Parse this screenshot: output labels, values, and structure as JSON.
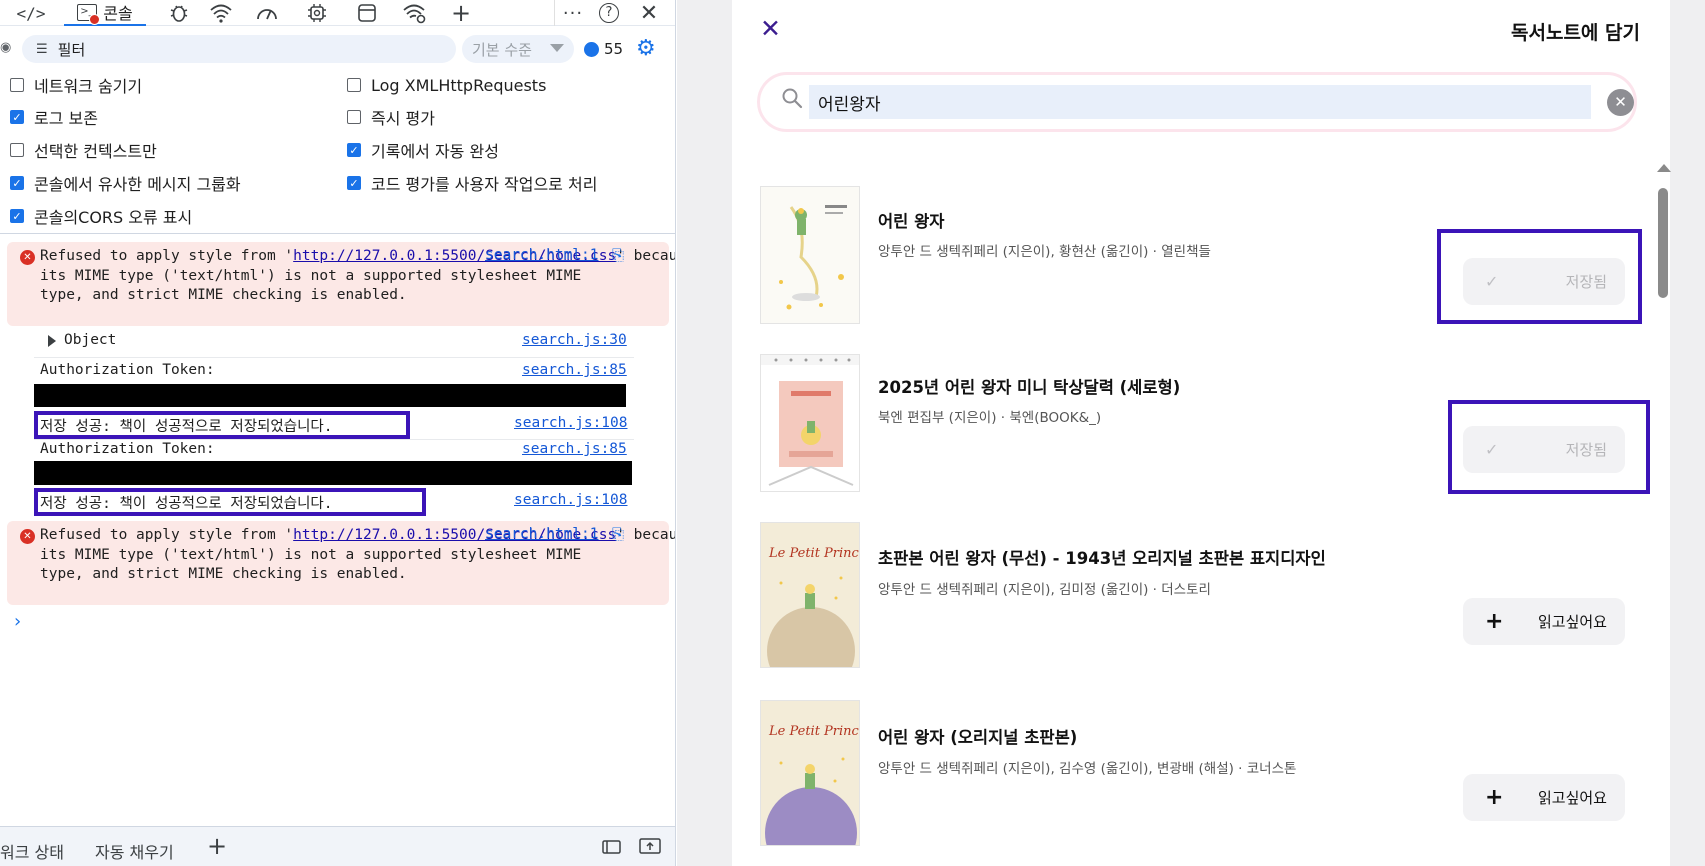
{
  "devtools": {
    "tabs": {
      "console_label": "콘솔"
    },
    "filter": {
      "placeholder": "필터",
      "level": "기본 수준",
      "message_count": "55"
    },
    "settings": [
      {
        "label": "네트워크 숨기기",
        "checked": false
      },
      {
        "label": "Log XMLHttpRequests",
        "checked": false
      },
      {
        "label": "로그 보존",
        "checked": true
      },
      {
        "label": "즉시 평가",
        "checked": false
      },
      {
        "label": "선택한 컨텍스트만",
        "checked": false
      },
      {
        "label": "기록에서 자동 완성",
        "checked": true
      },
      {
        "label": "콘솔에서 유사한 메시지 그룹화",
        "checked": true
      },
      {
        "label": "코드 평가를 사용자 작업으로 처리",
        "checked": true
      },
      {
        "label": "콘솔의CORS 오류 표시",
        "checked": true
      }
    ],
    "logs": {
      "error1": {
        "prefix": "Refused to apply style from '",
        "url": "http://127.0.0.1:5500/Search/home.css",
        "suffix": "' because\nits MIME type ('text/html') is not a supported stylesheet MIME\ntype, and strict MIME checking is enabled.",
        "source": "search.html:1"
      },
      "object": {
        "text": "Object",
        "source": "search.js:30"
      },
      "token1": {
        "text": "Authorization Token:",
        "source": "search.js:85"
      },
      "success1": {
        "text": "저장 성공: 책이 성공적으로 저장되었습니다.",
        "source": "search.js:108"
      },
      "token2": {
        "text": "Authorization Token:",
        "source": "search.js:85"
      },
      "success2": {
        "text": "저장 성공: 책이 성공적으로 저장되었습니다.",
        "source": "search.js:108"
      },
      "error2": {
        "prefix": "Refused to apply style from '",
        "url": "http://127.0.0.1:5500/Search/home.css",
        "suffix": "' because\nits MIME type ('text/html') is not a supported stylesheet MIME\ntype, and strict MIME checking is enabled.",
        "source": "search.html:1"
      }
    },
    "drawer": {
      "tab1": "워크 상태",
      "tab2": "자동 채우기"
    }
  },
  "modal": {
    "title": "독서노트에 담기",
    "search": {
      "value": "어린왕자"
    },
    "books": [
      {
        "title": "어린 왕자",
        "meta": "앙투안 드 생텍쥐페리 (지은이), 황현산 (옮긴이) · 열린책들",
        "action": "저장됨",
        "saved": true
      },
      {
        "title": "2025년 어린 왕자 미니 탁상달력 (세로형)",
        "meta": "북엔 편집부 (지은이) · 북엔(BOOK&_)",
        "action": "저장됨",
        "saved": true
      },
      {
        "title": "초판본 어린 왕자 (무선) - 1943년 오리지널 초판본 표지디자인",
        "meta": "앙투안 드 생텍쥐페리 (지은이), 김미정 (옮긴이) · 더스토리",
        "action": "읽고싶어요",
        "saved": false
      },
      {
        "title": "어린 왕자 (오리지널 초판본)",
        "meta": "앙투안 드 생텍쥐페리 (지은이), 김수영 (옮긴이), 변광배 (해설) · 코너스톤",
        "action": "읽고싶어요",
        "saved": false
      }
    ],
    "cover_art": {
      "le_petit_prince": "Le Petit Prince"
    }
  },
  "colors": {
    "accent": "#1a73e8",
    "highlight": "#3b14b8",
    "error_bg": "#fce8e6"
  }
}
